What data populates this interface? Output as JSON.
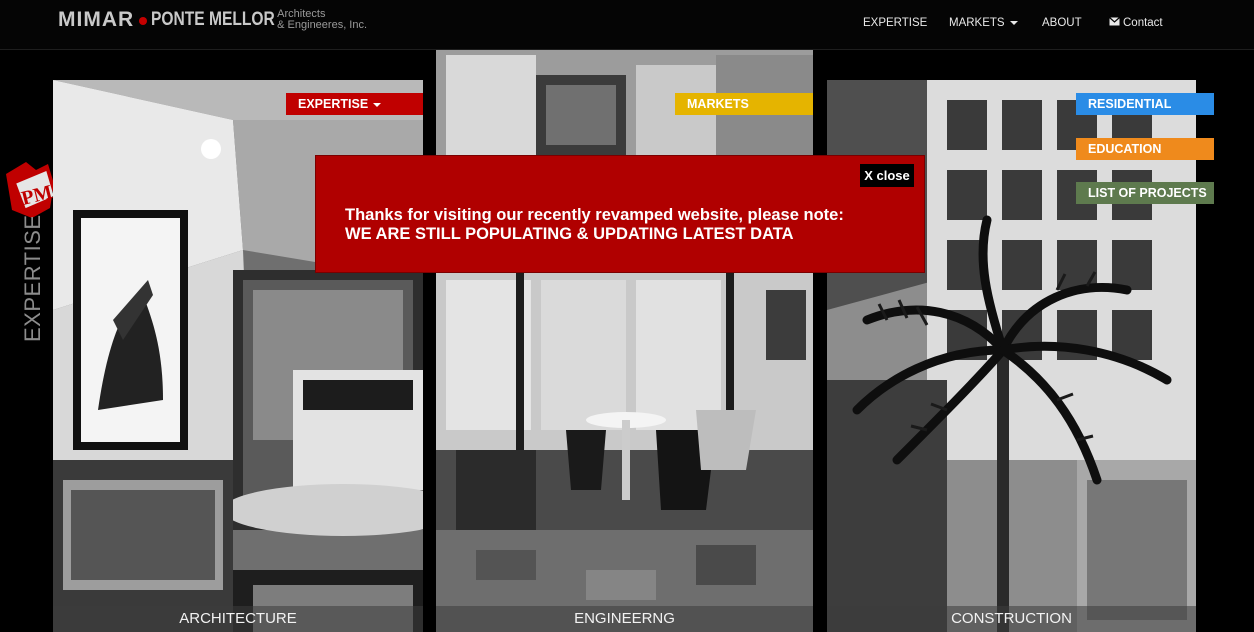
{
  "brand": {
    "name": "MIMAR",
    "second": "PONTE MELLOR",
    "tagline_1": "Architects",
    "tagline_2": "& Engineeres, Inc."
  },
  "nav": {
    "expertise": "EXPERTISE",
    "markets": "MARKETS",
    "about": "ABOUT",
    "contact": "Contact"
  },
  "side": {
    "logo_text": "PM",
    "label": "EXPERTISE"
  },
  "panels": {
    "left_caption": "ARCHITECTURE",
    "middle_caption": "ENGINEERNG",
    "right_caption": "CONSTRUCTION"
  },
  "tags": {
    "expertise": "EXPERTISE",
    "markets": "MARKETS",
    "residential": "RESIDENTIAL",
    "education": "EDUCATION",
    "projects": "LIST OF PROJECTS"
  },
  "colors": {
    "expertise": "#c00000",
    "markets": "#e5b400",
    "residential": "#2a8ce6",
    "education": "#ef8a1c",
    "projects": "#5e7a4e",
    "modal": "#b00000"
  },
  "modal": {
    "close_label": "X close",
    "line1": "Thanks for visiting our recently revamped website, please note:",
    "line2": "WE ARE STILL POPULATING & UPDATING LATEST DATA"
  }
}
